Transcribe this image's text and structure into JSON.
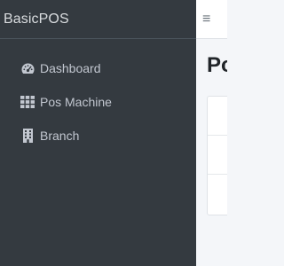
{
  "sidebar": {
    "brand": "BasicPOS",
    "items": [
      {
        "label": "Dashboard",
        "icon": "tachometer-icon"
      },
      {
        "label": "Pos Machine",
        "icon": "grid-icon"
      },
      {
        "label": "Branch",
        "icon": "building-icon"
      }
    ]
  },
  "header": {
    "menu_icon": "≡",
    "page_title": "Po"
  },
  "colors": {
    "sidebar_bg": "#343a40",
    "sidebar_text": "#c2c7d0",
    "content_bg": "#f4f6f9"
  }
}
